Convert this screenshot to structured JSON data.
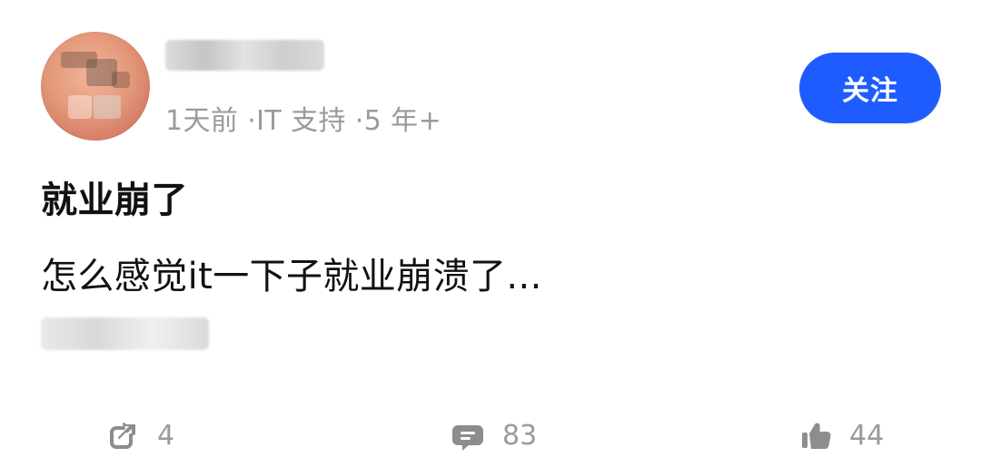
{
  "post": {
    "meta": "1天前 ·IT 支持 ·5 年+",
    "follow_label": "关注",
    "title": "就业崩了",
    "content": "怎么感觉it一下子就业崩溃了...",
    "actions": {
      "share_count": "4",
      "comment_count": "83",
      "like_count": "44"
    }
  },
  "icons": {
    "avatar": "avatar",
    "share": "share-icon",
    "comment": "comment-icon",
    "like": "thumbs-up-icon"
  },
  "colors": {
    "primary": "#1f5cff",
    "text": "#111111",
    "muted": "#9a9a9a"
  }
}
